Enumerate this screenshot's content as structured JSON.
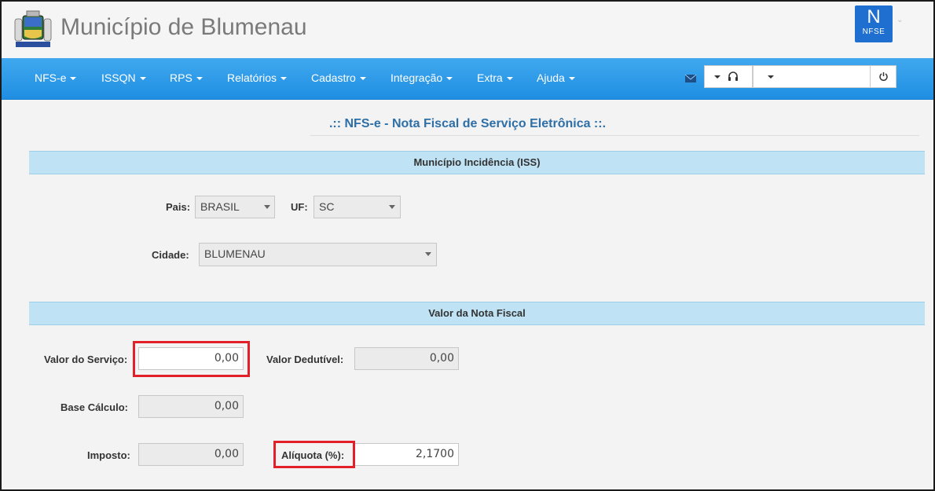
{
  "header": {
    "title": "Município de Blumenau",
    "logo_big": "N",
    "logo_small": "NFSE"
  },
  "nav": {
    "items": [
      {
        "label": "NFS-e"
      },
      {
        "label": "ISSQN"
      },
      {
        "label": "RPS"
      },
      {
        "label": "Relatórios"
      },
      {
        "label": "Cadastro"
      },
      {
        "label": "Integração"
      },
      {
        "label": "Extra"
      },
      {
        "label": "Ajuda"
      }
    ],
    "icons": {
      "mail": "mail-icon",
      "support": "headset-icon",
      "power": "power-icon"
    },
    "accent": "#2196e8"
  },
  "page": {
    "title": ".:: NFS-e - Nota Fiscal de Serviço Eletrônica ::."
  },
  "incidencia": {
    "section_label": "Município Incidência (ISS)",
    "pais_label": "Pais:",
    "pais_value": "BRASIL",
    "uf_label": "UF:",
    "uf_value": "SC",
    "cidade_label": "Cidade:",
    "cidade_value": "BLUMENAU"
  },
  "valor": {
    "section_label": "Valor da Nota Fiscal",
    "servico_label": "Valor do Serviço:",
    "servico_value": "0,00",
    "dedutivel_label": "Valor Dedutível:",
    "dedutivel_value": "0,00",
    "base_label": "Base Cálculo:",
    "base_value": "0,00",
    "imposto_label": "Imposto:",
    "imposto_value": "0,00",
    "aliquota_label": "Alíquota (%):",
    "aliquota_value": "2,1700"
  },
  "colors": {
    "highlight": "#e2202a",
    "section_bg": "#bfe3f5",
    "title": "#2e6fa7"
  }
}
